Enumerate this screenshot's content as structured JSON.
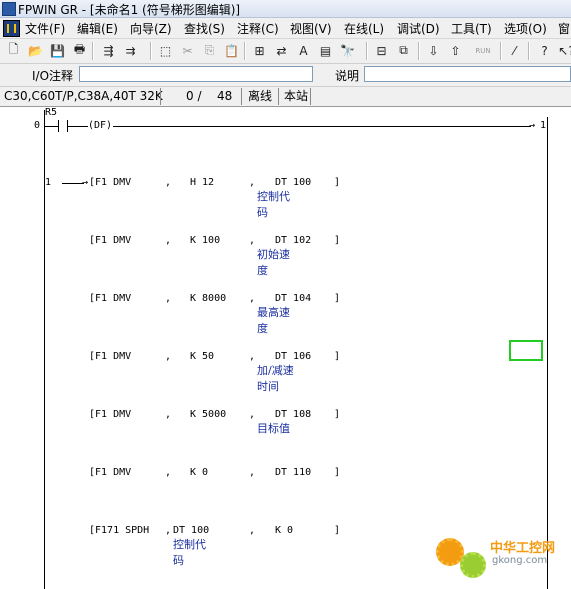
{
  "window": {
    "title": "FPWIN GR - [未命名1 (符号梯形图编辑)]"
  },
  "menu": [
    "文件(F)",
    "编辑(E)",
    "向导(Z)",
    "查找(S)",
    "注释(C)",
    "视图(V)",
    "在线(L)",
    "调试(D)",
    "工具(T)",
    "选项(O)",
    "窗"
  ],
  "toolbar": {
    "buttons": [
      {
        "icon": "new-file-icon",
        "glyph": "🗋"
      },
      {
        "icon": "open-folder-icon",
        "glyph": "📂"
      },
      {
        "icon": "save-icon",
        "glyph": "💾"
      },
      {
        "icon": "print-icon",
        "glyph": "🖶"
      },
      {
        "icon": "monitor-icon",
        "glyph": "⇶"
      },
      {
        "icon": "monitor-alt-icon",
        "glyph": "⇉"
      },
      {
        "icon": "select-icon",
        "glyph": "⬚"
      },
      {
        "icon": "cut-icon",
        "glyph": "✂"
      },
      {
        "icon": "copy-icon",
        "glyph": "⎘"
      },
      {
        "icon": "paste-icon",
        "glyph": "📋"
      },
      {
        "icon": "ladder-block-icon",
        "glyph": "⊞"
      },
      {
        "icon": "convert-icon",
        "glyph": "⇄"
      },
      {
        "icon": "text-icon",
        "glyph": "A"
      },
      {
        "icon": "column-icon",
        "glyph": "▤"
      },
      {
        "icon": "find-icon",
        "glyph": "🔭"
      },
      {
        "icon": "ladder-view-icon",
        "glyph": "⊟"
      },
      {
        "icon": "online-icon",
        "glyph": "⧉"
      },
      {
        "icon": "plc-read-icon",
        "glyph": "⇩"
      },
      {
        "icon": "plc-write-icon",
        "glyph": "⇧"
      },
      {
        "icon": "run-icon",
        "glyph": "RUN"
      },
      {
        "icon": "stop-icon",
        "glyph": "⁄"
      },
      {
        "icon": "help-icon",
        "glyph": "?"
      },
      {
        "icon": "context-help-icon",
        "glyph": "↖?"
      }
    ]
  },
  "comment_bar": {
    "io_label": "I/O注释",
    "io_value": "",
    "desc_label": "说明",
    "desc_value": ""
  },
  "status": {
    "plc_type": "C30,C60T/P,C38A,40T 32K",
    "steps": "0 /",
    "total": "48",
    "mode": "离线",
    "location": "本站"
  },
  "ladder": {
    "relay": "R5",
    "left_numbers": [
      "0",
      "1"
    ],
    "df": "(DF)",
    "right_number": "1",
    "rows": [
      {
        "instr": "[F1 DMV",
        "sep1": ",",
        "op1": "H 12",
        "sep2": ",",
        "op2": "DT 100",
        "close": "]",
        "comment": "控制代码",
        "ctarget": 2
      },
      {
        "instr": "[F1 DMV",
        "sep1": ",",
        "op1": "K 100",
        "sep2": ",",
        "op2": "DT 102",
        "close": "]",
        "comment": "初始速度",
        "ctarget": 2
      },
      {
        "instr": "[F1 DMV",
        "sep1": ",",
        "op1": "K 8000",
        "sep2": ",",
        "op2": "DT 104",
        "close": "]",
        "comment": "最高速度",
        "ctarget": 2
      },
      {
        "instr": "[F1 DMV",
        "sep1": ",",
        "op1": "K 50",
        "sep2": ",",
        "op2": "DT 106",
        "close": "]",
        "comment": "加/减速时间",
        "ctarget": 2
      },
      {
        "instr": "[F1 DMV",
        "sep1": ",",
        "op1": "K 5000",
        "sep2": ",",
        "op2": "DT 108",
        "close": "]",
        "comment": "目标值",
        "ctarget": 2
      },
      {
        "instr": "[F1 DMV",
        "sep1": ",",
        "op1": "K 0",
        "sep2": ",",
        "op2": "DT 110",
        "close": "]",
        "comment": "",
        "ctarget": 2
      },
      {
        "instr": "[F171 SPDH",
        "sep1": ",",
        "op1": "DT 100",
        "sep2": ",",
        "op2": "K 0",
        "close": "]",
        "comment": "控制代码",
        "ctarget": 1
      }
    ]
  },
  "watermark": {
    "brand": "中华工控网",
    "url": "gkong.com"
  }
}
